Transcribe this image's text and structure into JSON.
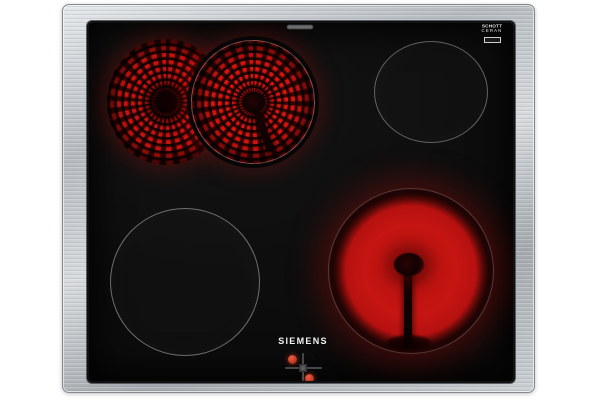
{
  "scene": {
    "description": "Product photo of a Siemens glass-ceramic cooktop with stainless steel trim; two radiant zones glowing red",
    "background_color": "#ffffff"
  },
  "branding": {
    "maker_logo": "SIEMENS",
    "glass_logo_line1": "SCHOTT",
    "glass_logo_line2": "CERAN"
  },
  "cooktop": {
    "frame_color": "#b9bec3",
    "glass_color": "#0c0c0c",
    "heat_glow_color": "#d81512",
    "zones": [
      {
        "id": "rear-left",
        "type": "dual-circuit radiant zone",
        "state": "on"
      },
      {
        "id": "rear-right",
        "type": "radiant zone",
        "state": "off"
      },
      {
        "id": "front-left",
        "type": "radiant zone",
        "state": "off"
      },
      {
        "id": "front-right",
        "type": "radiant zone",
        "state": "on"
      }
    ],
    "controls": {
      "type": "control cross with indicator dots",
      "indicator_color": "#c53a24"
    }
  }
}
